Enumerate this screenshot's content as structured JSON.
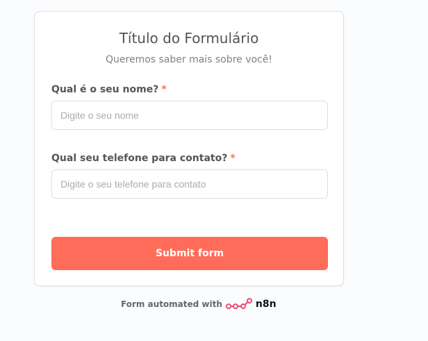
{
  "form": {
    "title": "Título do Formulário",
    "subtitle": "Queremos saber mais sobre você!",
    "fields": [
      {
        "label": "Qual é o seu nome?",
        "required_mark": "*",
        "value": "",
        "placeholder": "Digite o seu nome"
      },
      {
        "label": "Qual seu telefone para contato?",
        "required_mark": "*",
        "value": "",
        "placeholder": "Digite o seu telefone para contato"
      }
    ],
    "submit_label": "Submit form"
  },
  "footer": {
    "text": "Form automated with",
    "logo_text": "n8n",
    "logo_icon": "n8n-logo-icon"
  },
  "colors": {
    "accent": "#ff6d5a",
    "background": "#fbfcfe",
    "card": "#ffffff",
    "border": "#dbdfe7"
  }
}
